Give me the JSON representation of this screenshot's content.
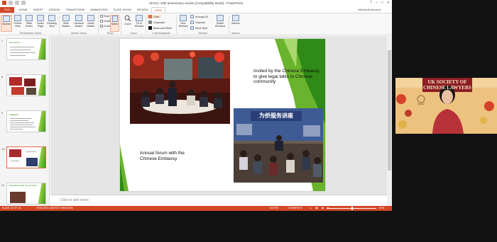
{
  "window": {
    "title": "UKSCL 10th anniversary review [Compatibility Mode] - PowerPoint",
    "account": "Microsoft account"
  },
  "ribbon_tabs": [
    "FILE",
    "HOME",
    "INSERT",
    "DESIGN",
    "TRANSITIONS",
    "ANIMATIONS",
    "SLIDE SHOW",
    "REVIEW",
    "VIEW"
  ],
  "active_tab": "VIEW",
  "ribbon": {
    "presentation_views": {
      "label": "Presentation Views",
      "buttons": [
        {
          "label": "Normal",
          "icon": "normal-view-icon",
          "selected": true
        },
        {
          "label": "Outline View",
          "icon": "outline-view-icon"
        },
        {
          "label": "Slide Sorter",
          "icon": "slide-sorter-icon"
        },
        {
          "label": "Notes Page",
          "icon": "notes-page-icon"
        },
        {
          "label": "Reading View",
          "icon": "reading-view-icon"
        }
      ]
    },
    "master_views": {
      "label": "Master Views",
      "buttons": [
        {
          "label": "Slide Master",
          "icon": "slide-master-icon"
        },
        {
          "label": "Handout Master",
          "icon": "handout-master-icon"
        },
        {
          "label": "Notes Master",
          "icon": "notes-master-icon"
        }
      ]
    },
    "show": {
      "label": "Show",
      "checkboxes": [
        "Ruler",
        "Gridlines",
        "Guides"
      ],
      "notes_button": "Notes"
    },
    "zoom": {
      "label": "Zoom",
      "buttons": [
        {
          "label": "Zoom",
          "icon": "zoom-icon"
        },
        {
          "label": "Fit to Window",
          "icon": "fit-to-window-icon"
        }
      ]
    },
    "color_grayscale": {
      "label": "Color/Grayscale",
      "options": [
        {
          "label": "Color",
          "color": "#e06c3c",
          "selected": true
        },
        {
          "label": "Grayscale",
          "color": "#888888"
        },
        {
          "label": "Black and White",
          "color": "#111111"
        }
      ]
    },
    "window": {
      "label": "Window",
      "new_window": "New Window",
      "items": [
        "Arrange All",
        "Cascade",
        "Move Split"
      ],
      "switch_windows": "Switch Windows"
    },
    "macros": {
      "label": "Macros",
      "button": "Macros"
    }
  },
  "thumbnails": [
    {
      "number": "7",
      "title": "Introduction",
      "selected": false
    },
    {
      "number": "8",
      "title": "",
      "selected": false
    },
    {
      "number": "9",
      "title": "Highlights",
      "selected": false
    },
    {
      "number": "10",
      "title": "",
      "selected": true
    },
    {
      "number": "11",
      "title": "Networking with the embassy",
      "selected": false
    }
  ],
  "slide": {
    "text_top": "Invited by the Chinese Embassy to give legal talks to Chinese community",
    "text_bottom": "Annual forum with the Chinese Embassy",
    "photo2_banner": "为侨服务讲座"
  },
  "notes_placeholder": "Click to add notes",
  "status_bar": {
    "slide_counter": "SLIDE 10 OF 28",
    "language": "ENGLISH (UNITED KINGDOM)",
    "notes": "NOTES",
    "comments": "COMMENTS",
    "zoom": "84%"
  },
  "webcam": {
    "banner_line1": "UK SOCIETY OF",
    "banner_line2": "CHINESE LAWYERS"
  },
  "colors": {
    "accent": "#d24726",
    "slide_green": "#6ab42d",
    "slide_green_dark": "#2f8a17",
    "banner_red": "#8e1d23"
  }
}
